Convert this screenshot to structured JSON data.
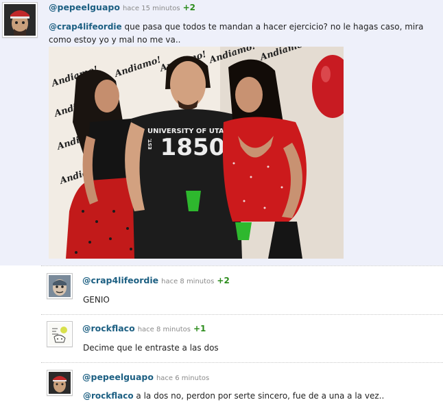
{
  "post": {
    "username": "@pepeelguapo",
    "time": "hace 15 minutos",
    "score": "+2",
    "mention": "@crap4lifeordie",
    "text": " que pasa que todos te mandan a hacer ejercicio? no le hagas caso, mira como estoy yo y mal no me va..",
    "photo": {
      "shirt_line1": "UNIVERSITY OF UTAH",
      "shirt_number": "1850",
      "shirt_est": "EST.",
      "wall_text": "Andiamo!"
    }
  },
  "replies": [
    {
      "username": "@crap4lifeordie",
      "time": "hace 8 minutos",
      "score": "+2",
      "mention": "",
      "text": "GENIO"
    },
    {
      "username": "@rockflaco",
      "time": "hace 8 minutos",
      "score": "+1",
      "mention": "",
      "text": "Decime que le entraste a las dos"
    },
    {
      "username": "@pepeelguapo",
      "time": "hace 6 minutos",
      "score": "",
      "mention": "@rockflaco",
      "text": " a la dos no, perdon por serte sincero, fue de a una a la vez.."
    }
  ],
  "colors": {
    "username": "#1c5f82",
    "score": "#2c8c1c",
    "time": "#8a8a8a",
    "post_bg": "#eef0fa"
  }
}
